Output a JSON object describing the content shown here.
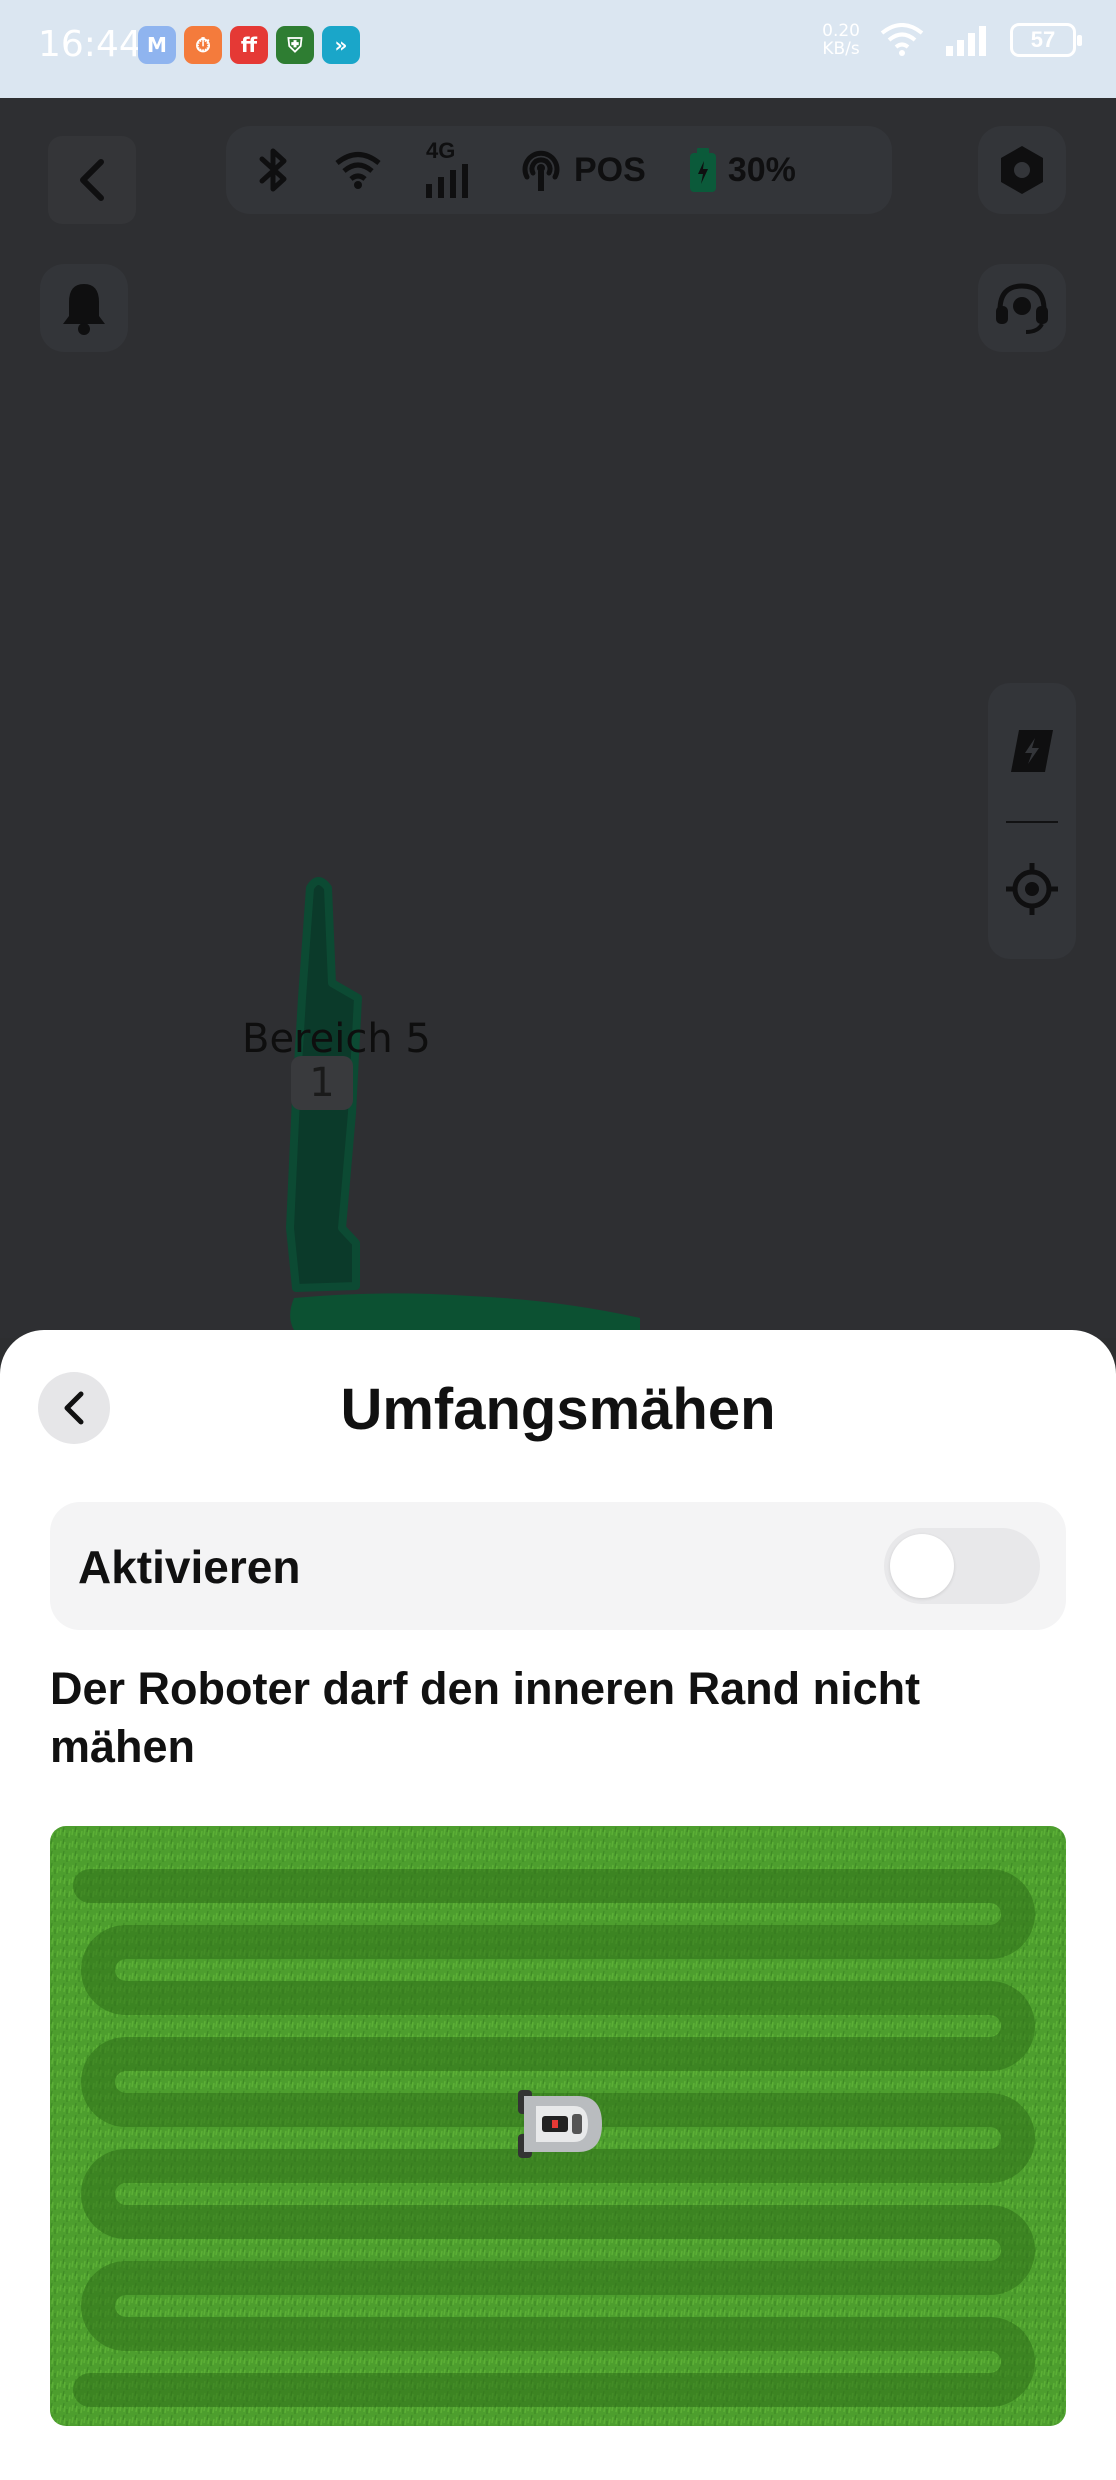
{
  "status_bar": {
    "time": "16:44",
    "net_speed_value": "0.20",
    "net_speed_unit": "KB/s",
    "battery": "57",
    "apps": [
      {
        "icon": "mail-app-icon",
        "glyph": "M",
        "color": "#8fb4ef"
      },
      {
        "icon": "timer-app-icon",
        "glyph": "⏱",
        "color": "#f47b3c"
      },
      {
        "icon": "red-app-icon",
        "glyph": "ff",
        "color": "#e53935"
      },
      {
        "icon": "shield-app-icon",
        "glyph": "⛨",
        "color": "#2e7d32"
      },
      {
        "icon": "arrow-app-icon",
        "glyph": "»",
        "color": "#1aa6c9"
      }
    ]
  },
  "map": {
    "connectivity": {
      "network_label": "4G",
      "position_label": "POS",
      "battery_percent": "30%"
    },
    "zone": {
      "name": "Bereich 5",
      "number": "1"
    }
  },
  "sheet": {
    "title": "Umfangsmähen",
    "toggle_label": "Aktivieren",
    "toggle_on": false,
    "description": "Der Roboter darf den inneren Rand nicht mähen"
  },
  "colors": {
    "map_bg": "#2e2f32",
    "zone_green": "#0b3a2a",
    "lawn_green": "#4a9a2c",
    "lawn_stripe": "#3e8424"
  }
}
